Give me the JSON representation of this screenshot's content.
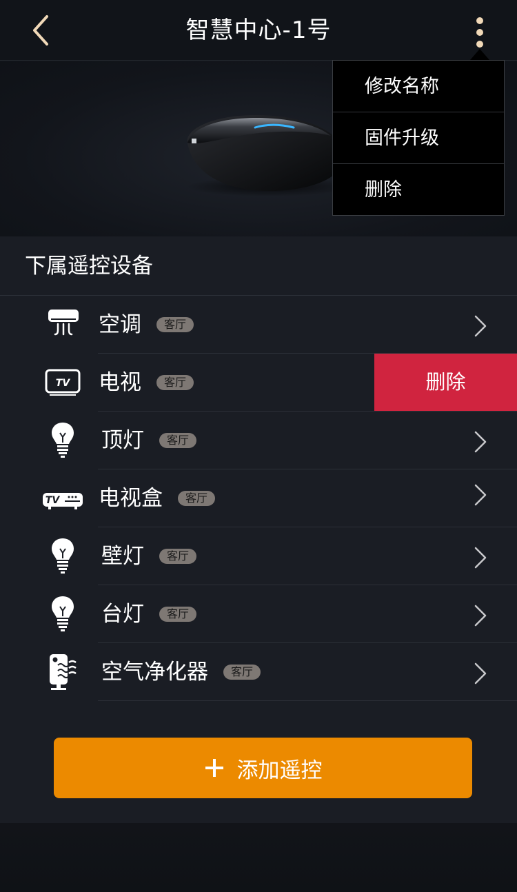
{
  "header": {
    "title": "智慧中心-1号",
    "back_icon": "chevron-left-icon",
    "more_icon": "more-vertical-icon",
    "accent_color": "#f1d9b8"
  },
  "menu": {
    "items": [
      {
        "label": "修改名称"
      },
      {
        "label": "固件升级"
      },
      {
        "label": "删除"
      }
    ]
  },
  "hero": {
    "device_image": "smart-hub-device"
  },
  "section": {
    "title": "下属遥控设备"
  },
  "devices": [
    {
      "name": "空调",
      "room": "客厅",
      "icon": "air-conditioner-icon"
    },
    {
      "name": "电视",
      "room": "客厅",
      "icon": "tv-icon",
      "swiped": true
    },
    {
      "name": "顶灯",
      "room": "客厅",
      "icon": "bulb-icon"
    },
    {
      "name": "电视盒",
      "room": "客厅",
      "icon": "tv-box-icon"
    },
    {
      "name": "壁灯",
      "room": "客厅",
      "icon": "bulb-icon"
    },
    {
      "name": "台灯",
      "room": "客厅",
      "icon": "bulb-icon"
    },
    {
      "name": "空气净化器",
      "room": "客厅",
      "icon": "air-purifier-icon"
    }
  ],
  "swipe_action": {
    "delete_label": "删除",
    "color": "#d0243f"
  },
  "add_button": {
    "label": "添加遥控",
    "icon": "plus-icon",
    "color": "#ec8a00"
  }
}
